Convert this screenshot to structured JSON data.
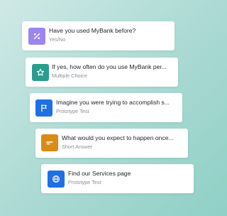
{
  "questions": [
    {
      "title": "Have you used MyBank before?",
      "type": "Yes/No",
      "icon": "percent-icon",
      "color": "#9b86f0"
    },
    {
      "title": "If yes, how often do you use MyBank per...",
      "type": "Multiple Choice",
      "icon": "star-icon",
      "color": "#2a9d8f"
    },
    {
      "title": "Imagine you were trying to accomplish s...",
      "type": "Prototype Test",
      "icon": "flag-icon",
      "color": "#1f6fe5"
    },
    {
      "title": "What would you expect to happen once...",
      "type": "Short Answer",
      "icon": "short-answer-icon",
      "color": "#d98a17"
    },
    {
      "title": "Find our Services page",
      "type": "Prototype Test",
      "icon": "globe-icon",
      "color": "#1f6fe5"
    }
  ]
}
